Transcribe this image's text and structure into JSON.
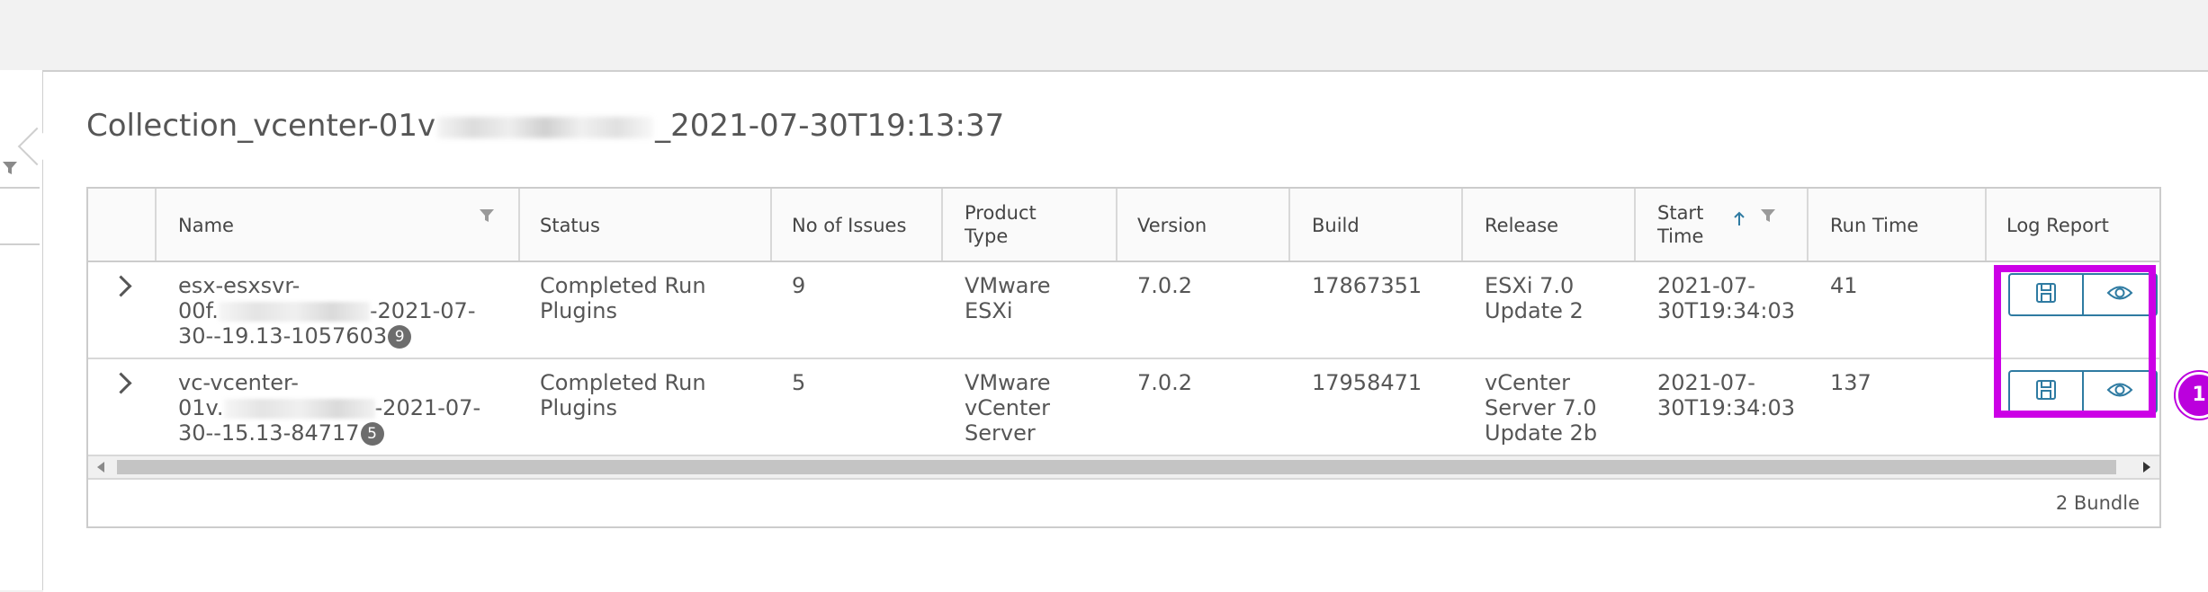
{
  "page": {
    "title_prefix": "Collection_vcenter-01v",
    "title_suffix": "_2021-07-30T19:13:37"
  },
  "table": {
    "columns": [
      {
        "label": "Name",
        "filter": true
      },
      {
        "label": "Status"
      },
      {
        "label": "No of Issues"
      },
      {
        "label": "Product Type"
      },
      {
        "label": "Version"
      },
      {
        "label": "Build"
      },
      {
        "label": "Release"
      },
      {
        "label": "Start Time",
        "sort": "ascending",
        "filter": true
      },
      {
        "label": "Run Time"
      },
      {
        "label": "Log Report"
      }
    ],
    "header": {
      "name": "Name",
      "status": "Status",
      "issues": "No of Issues",
      "product_line1": "Product",
      "product_line2": "Type",
      "version": "Version",
      "build": "Build",
      "release": "Release",
      "start_line1": "Start",
      "start_line2": "Time",
      "runtime": "Run Time",
      "logreport": "Log Report"
    },
    "rows": [
      {
        "name_line1": "esx-esxsvr-",
        "name_line2_prefix": "00f.",
        "name_line2_suffix": "-2021-07-",
        "name_line3": "30--19.13-1057603",
        "name_badge": "9",
        "status_line1": "Completed Run",
        "status_line2": "Plugins",
        "issues": "9",
        "product_line1": "VMware",
        "product_line2": "ESXi",
        "product_line3": "",
        "version": "7.0.2",
        "build": "17867351",
        "release_line1": "ESXi 7.0",
        "release_line2": "Update 2",
        "release_line3": "",
        "start_line1": "2021-07-",
        "start_line2": "30T19:34:03",
        "runtime": "41"
      },
      {
        "name_line1": "vc-vcenter-",
        "name_line2_prefix": "01v.",
        "name_line2_suffix": "-2021-07-",
        "name_line3": "30--15.13-84717",
        "name_badge": "5",
        "status_line1": "Completed Run",
        "status_line2": "Plugins",
        "issues": "5",
        "product_line1": "VMware",
        "product_line2": "vCenter",
        "product_line3": "Server",
        "version": "7.0.2",
        "build": "17958471",
        "release_line1": "vCenter",
        "release_line2": "Server 7.0",
        "release_line3": "Update 2b",
        "start_line1": "2021-07-",
        "start_line2": "30T19:34:03",
        "runtime": "137"
      }
    ],
    "footer": "2 Bundle"
  },
  "annotation": {
    "marker_label": "1",
    "highlight_color": "#cc00e6"
  },
  "icons": [
    "filter-icon",
    "sort-ascending-icon",
    "expand-chevron-icon",
    "save-icon",
    "view-eye-icon"
  ],
  "colors": {
    "accent": "#2f7ba2",
    "highlight": "#cc00e6",
    "badge": "#6d6d6d"
  }
}
